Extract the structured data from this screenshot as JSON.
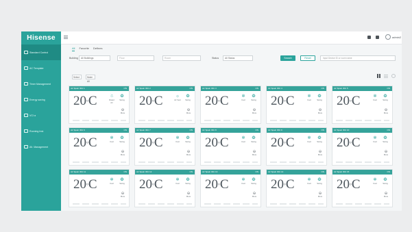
{
  "app": {
    "logo": "Hisense"
  },
  "sidebar": {
    "items": [
      {
        "label": "Standard Control",
        "icon": "monitor-icon",
        "active": true
      },
      {
        "label": "AC Template",
        "icon": "users-icon",
        "active": false
      },
      {
        "label": "Timer Management",
        "icon": "clock-icon",
        "active": false
      },
      {
        "label": "Energy saving",
        "icon": "energy-icon",
        "active": false
      },
      {
        "label": "VCI a",
        "icon": "chart-icon",
        "active": false
      },
      {
        "label": "Running Inst.",
        "icon": "grid-icon",
        "active": false
      },
      {
        "label": "Alt. Management",
        "icon": "user-gear-icon",
        "active": false
      }
    ]
  },
  "header": {
    "user_name": "admin2"
  },
  "tabs": [
    {
      "label": "All",
      "active": true
    },
    {
      "label": "Favorite",
      "active": false
    },
    {
      "label": "Defines",
      "active": false
    }
  ],
  "filters": {
    "building_label": "Building",
    "building_value": "All Buildings",
    "floor_placeholder": "Floor",
    "room_placeholder": "Room",
    "status_label": "Status",
    "status_value": "All Status",
    "search_button": "Search",
    "reset_button": "Reset",
    "keyword_placeholder": "Input Device ID or room name"
  },
  "toolbar": {
    "select_all": "Select",
    "mode_select": "Mode All"
  },
  "cards": [
    {
      "name": "Air Spain IDU 1",
      "status": "ON",
      "temperature": "20",
      "unit": "C",
      "modes": [
        {
          "icon": "☃",
          "label": "Rated Air"
        },
        {
          "icon": "❂",
          "label": "Swing"
        }
      ],
      "more": "More"
    },
    {
      "name": "Air Spain IDU 2",
      "status": "ON",
      "temperature": "20",
      "unit": "C",
      "modes": [
        {
          "icon": "☼",
          "label": "Air Vent"
        },
        {
          "icon": "❂",
          "label": "Swing"
        }
      ],
      "more": "More"
    },
    {
      "name": "Air Spain IDU 3",
      "status": "ON",
      "temperature": "20",
      "unit": "C",
      "modes": [
        {
          "icon": "✲",
          "label": "Cool"
        },
        {
          "icon": "❂",
          "label": "Swing"
        }
      ],
      "more": "More"
    },
    {
      "name": "Air Spain IDU 4",
      "status": "ON",
      "temperature": "20",
      "unit": "C",
      "modes": [
        {
          "icon": "✲",
          "label": "Cool"
        },
        {
          "icon": "❂",
          "label": "Swing"
        }
      ],
      "more": "More"
    },
    {
      "name": "Air Spain IDU 5",
      "status": "ON",
      "temperature": "20",
      "unit": "C",
      "modes": [
        {
          "icon": "✲",
          "label": "Cool"
        },
        {
          "icon": "❂",
          "label": "Swing"
        }
      ],
      "more": "More"
    },
    {
      "name": "Air Spain IDU 6",
      "status": "ON",
      "temperature": "20",
      "unit": "C",
      "modes": [
        {
          "icon": "✲",
          "label": "Cool"
        },
        {
          "icon": "❂",
          "label": "Swing"
        }
      ],
      "more": "More"
    },
    {
      "name": "Air Spain IDU 7",
      "status": "ON",
      "temperature": "20",
      "unit": "C",
      "modes": [
        {
          "icon": "✲",
          "label": "Cool"
        },
        {
          "icon": "❂",
          "label": "Swing"
        }
      ],
      "more": "More"
    },
    {
      "name": "Air Spain IDU 8",
      "status": "ON",
      "temperature": "20",
      "unit": "C",
      "modes": [
        {
          "icon": "✲",
          "label": "Cool"
        },
        {
          "icon": "❂",
          "label": "Swing"
        }
      ],
      "more": "More"
    },
    {
      "name": "Air Spain IDU 9",
      "status": "ON",
      "temperature": "20",
      "unit": "C",
      "modes": [
        {
          "icon": "✲",
          "label": "Cool"
        },
        {
          "icon": "❂",
          "label": "Swing"
        }
      ],
      "more": "More"
    },
    {
      "name": "Air Spain IDU 10",
      "status": "ON",
      "temperature": "20",
      "unit": "C",
      "modes": [
        {
          "icon": "✲",
          "label": "Cool"
        },
        {
          "icon": "❂",
          "label": "Swing"
        }
      ],
      "more": "More"
    },
    {
      "name": "Air Spain IDU 11",
      "status": "ON",
      "temperature": "20",
      "unit": "C",
      "modes": [
        {
          "icon": "✲",
          "label": "Cool"
        },
        {
          "icon": "❂",
          "label": "Swing"
        }
      ],
      "more": "More"
    },
    {
      "name": "Air Spain IDU 12",
      "status": "ON",
      "temperature": "20",
      "unit": "C",
      "modes": [
        {
          "icon": "✲",
          "label": "Cool"
        },
        {
          "icon": "❂",
          "label": "Swing"
        }
      ],
      "more": "More"
    },
    {
      "name": "Air Spain IDU 13",
      "status": "ON",
      "temperature": "20",
      "unit": "C",
      "modes": [
        {
          "icon": "✲",
          "label": "Cool"
        },
        {
          "icon": "❂",
          "label": "Swing"
        }
      ],
      "more": "More"
    },
    {
      "name": "Air Spain IDU 14",
      "status": "ON",
      "temperature": "20",
      "unit": "C",
      "modes": [
        {
          "icon": "✲",
          "label": "Cool"
        },
        {
          "icon": "❂",
          "label": "Swing"
        }
      ],
      "more": "More"
    },
    {
      "name": "Air Spain IDU 15",
      "status": "ON",
      "temperature": "20",
      "unit": "C",
      "modes": [
        {
          "icon": "✲",
          "label": "Cool"
        },
        {
          "icon": "❂",
          "label": "Swing"
        }
      ],
      "more": "More"
    }
  ],
  "colors": {
    "accent": "#2aa39b",
    "card_header": "#35a39a",
    "background": "#ecedee"
  }
}
